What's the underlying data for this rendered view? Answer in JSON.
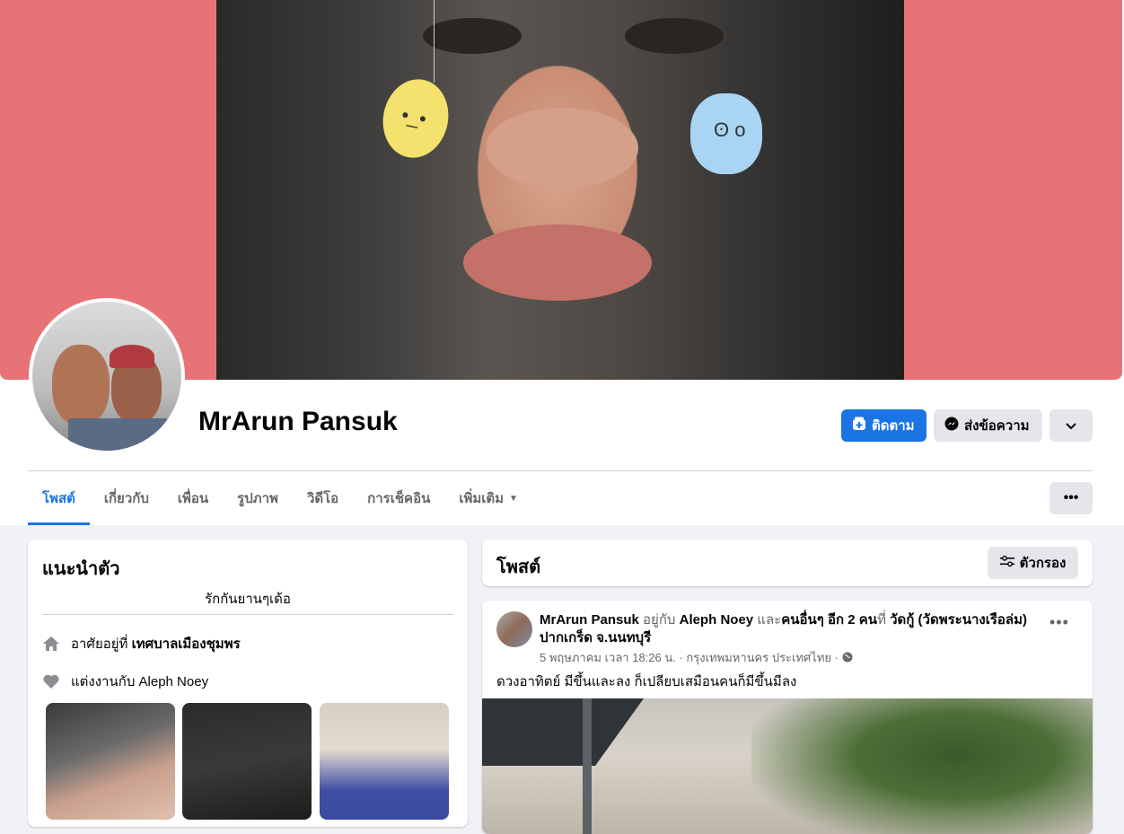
{
  "profile": {
    "name": "MrArun Pansuk"
  },
  "actions": {
    "follow_label": "ติดตาม",
    "message_label": "ส่งข้อความ"
  },
  "tabs": [
    {
      "label": "โพสต์",
      "active": true
    },
    {
      "label": "เกี่ยวกับ"
    },
    {
      "label": "เพื่อน"
    },
    {
      "label": "รูปภาพ"
    },
    {
      "label": "วิดีโอ"
    },
    {
      "label": "การเช็คอิน"
    },
    {
      "label": "เพิ่มเติม"
    }
  ],
  "intro": {
    "title": "แนะนำตัว",
    "bio": "รักกันยานๆเด้อ",
    "lives_prefix": "อาศัยอยู่ที่",
    "lives_place": "เทศบาลเมืองชุมพร",
    "married_prefix": "แต่งงานกับ",
    "married_to": "Aleph Noey"
  },
  "posts_section": {
    "title": "โพสต์",
    "filter_label": "ตัวกรอง"
  },
  "post": {
    "author": "MrArun Pansuk",
    "with_text": "อยู่กับ",
    "with_name": "Aleph Noey",
    "and_text": "และ",
    "others": "คนอื่นๆ อีก 2 คน",
    "at_text": "ที่",
    "place": "วัดกู้ (วัดพระนางเรือล่ม) ปากเกร็ด จ.นนทบุรี",
    "meta": "5 พฤษภาคม เวลา 18:26 น. · กรุงเทพมหานคร ประเทศไทย ·",
    "text": "ดวงอาทิตย์  มีขึ้นและลง   ก็เปลียบเสมือนคนก็มีขึ้นมีลง"
  },
  "colors": {
    "accent": "#1b74e4",
    "cover_bg": "#e87376",
    "page_bg": "#f0f2f5"
  }
}
